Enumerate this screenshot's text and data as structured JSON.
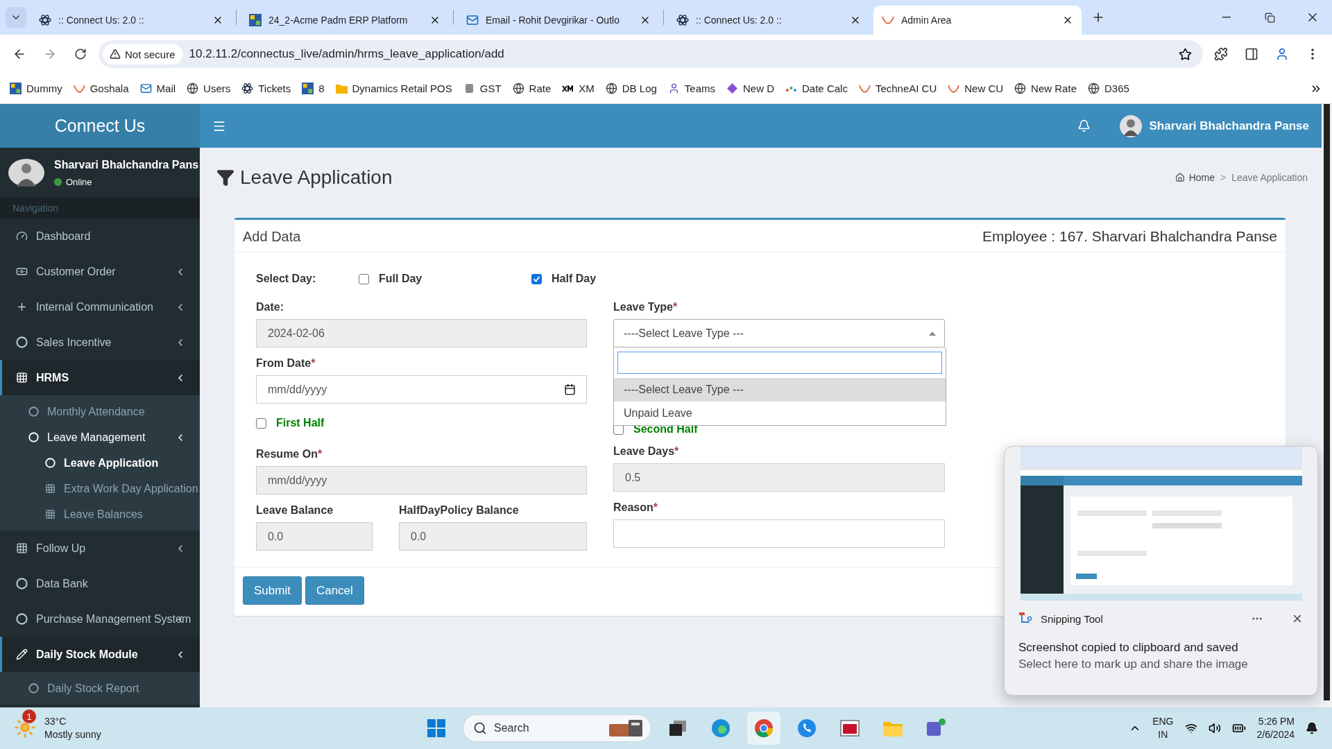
{
  "browser": {
    "tabs": [
      {
        "title": ":: Connect Us: 2.0 ::",
        "selected": false
      },
      {
        "title": "24_2-Acme Padm ERP Platform",
        "selected": false
      },
      {
        "title": "Email - Rohit Devgirikar - Outlo",
        "selected": false
      },
      {
        "title": ":: Connect Us: 2.0 ::",
        "selected": false
      },
      {
        "title": "Admin Area",
        "selected": true
      }
    ],
    "address": {
      "security": "Not secure",
      "url": "10.2.11.2/connectus_live/admin/hrms_leave_application/add"
    },
    "bookmarks": [
      "Dummy",
      "Goshala",
      "Mail",
      "Users",
      "Tickets",
      "8",
      "Dynamics Retail POS",
      "GST",
      "Rate",
      "XM",
      "DB Log",
      "Teams",
      "New D",
      "Date Calc",
      "TechneAI CU",
      "New CU",
      "New Rate",
      "D365"
    ]
  },
  "app": {
    "brand": "Connect Us",
    "header_user": "Sharvari Bhalchandra Panse",
    "sidebar": {
      "user": {
        "name": "Sharvari Bhalchandra Pans",
        "status": "Online"
      },
      "heading": "Navigation",
      "items": [
        {
          "label": "Dashboard",
          "submenu": false,
          "selected": false
        },
        {
          "label": "Customer Order",
          "submenu": true,
          "selected": false
        },
        {
          "label": "Internal Communication",
          "submenu": true,
          "selected": false
        },
        {
          "label": "Sales Incentive",
          "submenu": true,
          "selected": false
        },
        {
          "label": "HRMS",
          "submenu": true,
          "selected": true,
          "children": [
            {
              "label": "Monthly Attendance",
              "submenu": false,
              "selected": false
            },
            {
              "label": "Leave Management",
              "submenu": true,
              "selected": true,
              "children": [
                {
                  "label": "Leave Application",
                  "submenu": false,
                  "selected": true
                },
                {
                  "label": "Extra Work Day Application",
                  "submenu": false,
                  "selected": false
                },
                {
                  "label": "Leave Balances",
                  "submenu": false,
                  "selected": false
                }
              ]
            }
          ]
        },
        {
          "label": "Follow Up",
          "submenu": true,
          "selected": false
        },
        {
          "label": "Data Bank",
          "submenu": false,
          "selected": false
        },
        {
          "label": "Purchase Management System",
          "submenu": true,
          "selected": false
        },
        {
          "label": "Daily Stock Module",
          "submenu": true,
          "selected": true,
          "children": [
            {
              "label": "Daily Stock Report",
              "submenu": false,
              "selected": false
            }
          ]
        }
      ]
    },
    "page": {
      "title": "Leave Application",
      "breadcrumb": [
        "Home",
        "Leave Application"
      ],
      "breadcrumb_separator": ">",
      "card": {
        "title": "Add Data",
        "employee": "Employee : 167. Sharvari Bhalchandra Panse",
        "select_day": {
          "label": "Select Day:",
          "options": [
            {
              "label": "Full Day",
              "checked": false
            },
            {
              "label": "Half Day",
              "checked": true
            }
          ]
        },
        "date": {
          "label": "Date:",
          "value": "2024-02-06",
          "disabled": true
        },
        "from_date": {
          "label": "From Date",
          "mark": "*",
          "placeholder": "mm/dd/yyyy",
          "disabled": false
        },
        "halves": [
          {
            "label": "First Half",
            "checked": false
          },
          {
            "label": "Second Half",
            "checked": false
          }
        ],
        "resume_on": {
          "label": "Resume On",
          "mark": "*",
          "placeholder": "mm/dd/yyyy",
          "disabled": true
        },
        "leave_type": {
          "label": "Leave Type",
          "mark": "*",
          "value": "----Select Leave Type ---",
          "expanded": true,
          "options": [
            {
              "label": "----Select Leave Type ---",
              "selected": true
            },
            {
              "label": "Unpaid Leave",
              "selected": false
            }
          ]
        },
        "leave_days": {
          "label": "Leave Days",
          "mark": "*",
          "value": "0.5",
          "disabled": true
        },
        "leave_balance": {
          "label": "Leave Balance",
          "value": "0.0",
          "disabled": true
        },
        "halfday_balance": {
          "label": "HalfDayPolicy Balance",
          "value": "0.0",
          "disabled": true
        },
        "reason": {
          "label": "Reason",
          "mark": "*",
          "disabled": false
        },
        "buttons": [
          "Submit",
          "Cancel"
        ]
      }
    }
  },
  "notification": {
    "app": "Snipping Tool",
    "title": "Screenshot copied to clipboard and saved",
    "body": "Select here to mark up and share the image"
  },
  "taskbar": {
    "weather": {
      "badge": "1",
      "temp": "33°C",
      "text": "Mostly sunny"
    },
    "search": {
      "placeholder": "Search"
    },
    "language": [
      "ENG",
      "IN"
    ],
    "time": "5:26 PM",
    "date": "2/6/2024"
  }
}
